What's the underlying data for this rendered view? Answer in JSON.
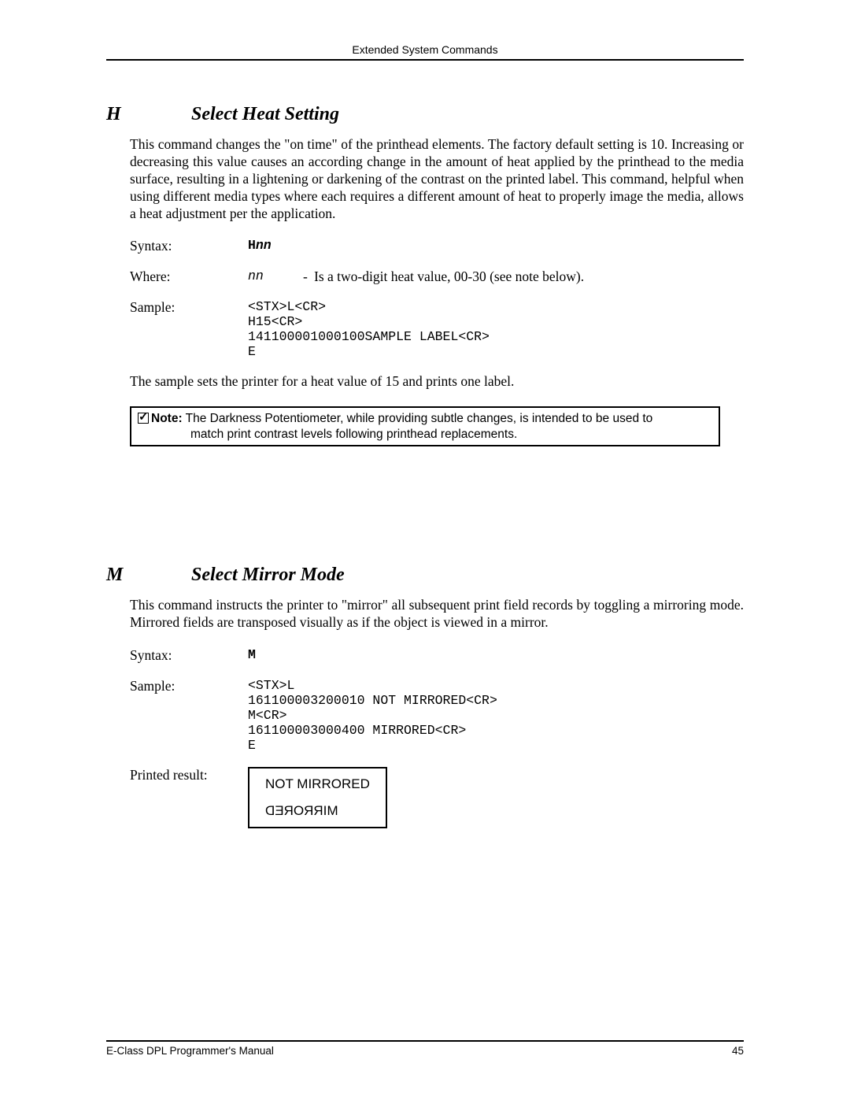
{
  "header": "Extended System Commands",
  "footer_left": "E-Class DPL Programmer's Manual",
  "footer_right": "45",
  "sectionH": {
    "letter": "H",
    "title": "Select Heat Setting",
    "body": "This command changes the \"on time\" of the printhead elements. The factory default setting is 10. Increasing or decreasing this value causes an according change in the amount of heat applied by the printhead to the media surface, resulting in a lightening or darkening of the contrast on the printed label. This command, helpful when using different media types where each requires a different amount of heat to properly image the media, allows a heat adjustment per the application.",
    "syntax_label": "Syntax:",
    "syntax_prefix": "H",
    "syntax_var": "nn",
    "where_label": "Where:",
    "where_var": "nn",
    "where_desc": "Is a two-digit heat value, 00-30 (see note below).",
    "sample_label": "Sample:",
    "sample": "<STX>L<CR>\nH15<CR>\n141100001000100SAMPLE LABEL<CR>\nE",
    "sample_explain": "The sample sets the printer for a heat value of 15 and prints one label.",
    "note_label": "Note:",
    "note_line1": "The Darkness Potentiometer, while providing subtle changes, is intended to be used to",
    "note_line2": "match print contrast levels following printhead replacements."
  },
  "sectionM": {
    "letter": "M",
    "title": "Select Mirror Mode",
    "body": "This command instructs the printer to \"mirror\" all subsequent print field records by toggling a mirroring mode. Mirrored fields are transposed visually as if the object is viewed in a mirror.",
    "syntax_label": "Syntax:",
    "syntax": "M",
    "sample_label": "Sample:",
    "sample": "<STX>L\n161100003200010 NOT MIRRORED<CR>\nM<CR>\n161100003000400 MIRRORED<CR>\nE",
    "result_label": "Printed result:",
    "result_top": "NOT MIRRORED",
    "result_bottom": "MIRRORED"
  }
}
